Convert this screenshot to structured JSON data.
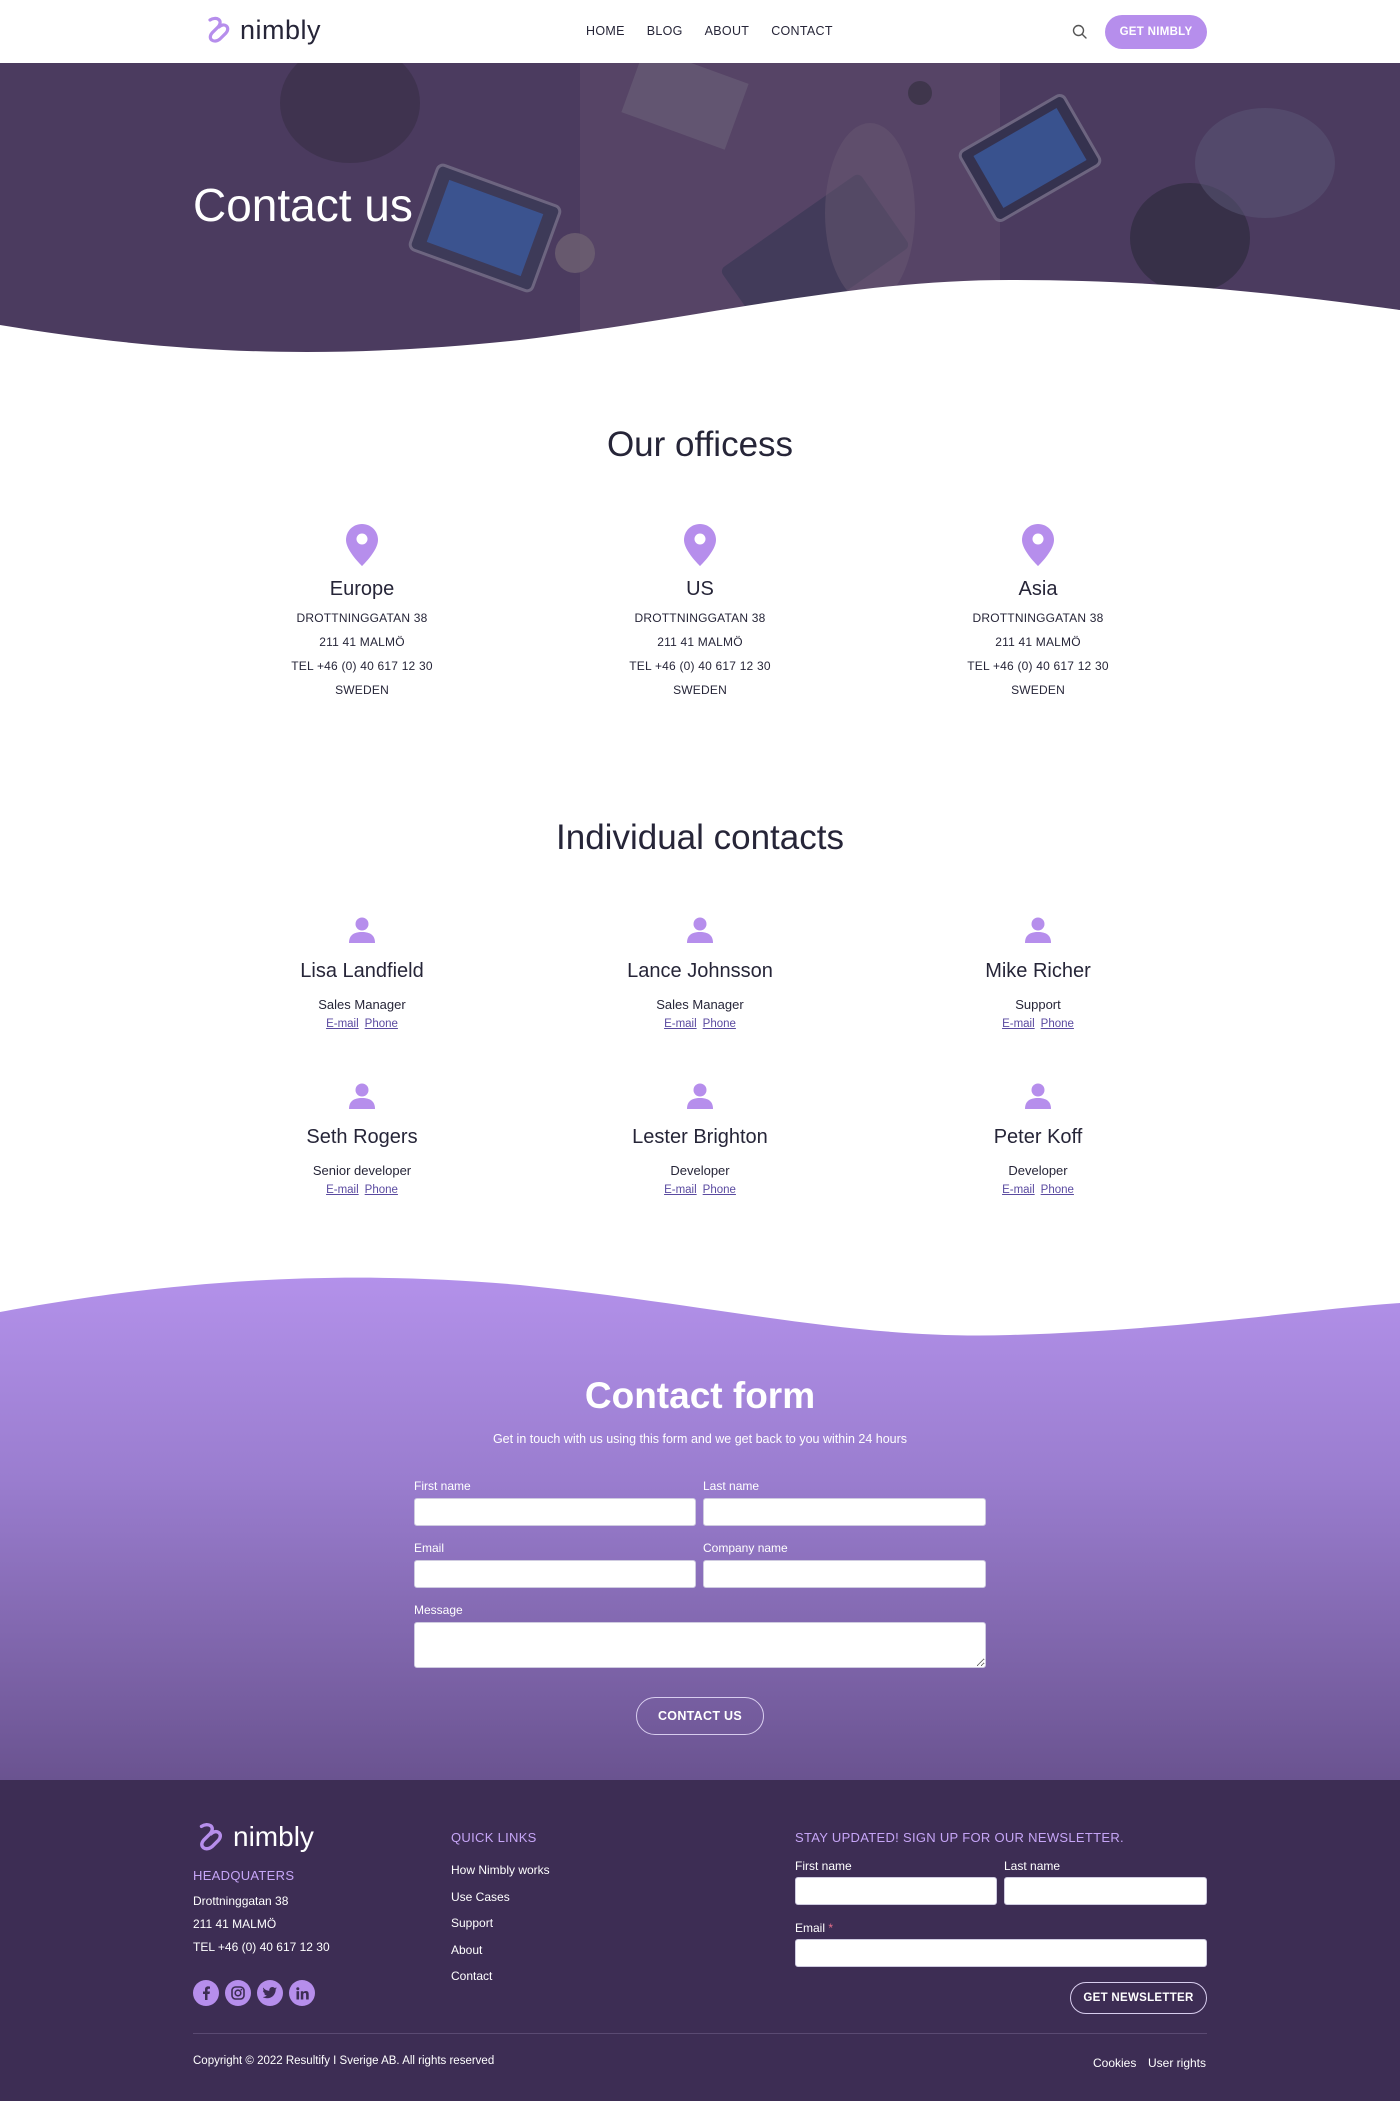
{
  "header": {
    "logo_text": "nimbly",
    "nav": [
      "HOME",
      "BLOG",
      "ABOUT",
      "CONTACT"
    ],
    "cta_label": "GET NIMBLY"
  },
  "hero": {
    "title": "Contact us"
  },
  "offices": {
    "title": "Our officess",
    "items": [
      {
        "name": "Europe",
        "lines": [
          "DROTTNINGGATAN 38",
          "211 41 MALMÖ",
          "TEL +46 (0) 40 617 12 30",
          "SWEDEN"
        ]
      },
      {
        "name": "US",
        "lines": [
          "DROTTNINGGATAN 38",
          "211 41 MALMÖ",
          "TEL +46 (0) 40 617 12 30",
          "SWEDEN"
        ]
      },
      {
        "name": "Asia",
        "lines": [
          "DROTTNINGGATAN 38",
          "211 41 MALMÖ",
          "TEL +46 (0) 40 617 12 30",
          "SWEDEN"
        ]
      }
    ]
  },
  "contacts": {
    "title": "Individual contacts",
    "email_label": "E-mail",
    "phone_label": "Phone",
    "people": [
      {
        "name": "Lisa Landfield",
        "role": "Sales Manager"
      },
      {
        "name": "Lance Johnsson",
        "role": "Sales Manager"
      },
      {
        "name": "Mike Richer",
        "role": "Support"
      },
      {
        "name": "Seth Rogers",
        "role": "Senior developer"
      },
      {
        "name": "Lester Brighton",
        "role": "Developer"
      },
      {
        "name": "Peter Koff",
        "role": "Developer"
      }
    ]
  },
  "form": {
    "title": "Contact form",
    "subtitle": "Get in touch with us using this form and we get back to you within 24 hours",
    "first_name_label": "First name",
    "last_name_label": "Last name",
    "email_label": "Email",
    "company_label": "Company name",
    "message_label": "Message",
    "submit_label": "CONTACT US"
  },
  "footer": {
    "logo_text": "nimbly",
    "hq_title": "HEADQUATERS",
    "hq_lines": [
      "Drottninggatan 38",
      "211 41 MALMÖ",
      "TEL +46 (0) 40 617 12 30"
    ],
    "quick_links_title": "QUICK LINKS",
    "quick_links": [
      "How Nimbly works",
      "Use Cases",
      "Support",
      "About",
      "Contact"
    ],
    "newsletter_title": "STAY UPDATED! SIGN UP FOR OUR NEWSLETTER.",
    "nl_first_name_label": "First name",
    "nl_last_name_label": "Last name",
    "nl_email_label": "Email",
    "nl_required_mark": "*",
    "nl_submit_label": "GET NEWSLETTER",
    "copyright": "Copyright © 2022 Resultify I Sverige AB. All rights reserved",
    "bottom_links": [
      "Cookies",
      "User rights"
    ],
    "social": [
      "facebook-icon",
      "instagram-icon",
      "twitter-icon",
      "linkedin-icon"
    ]
  },
  "colors": {
    "accent": "#b68eec",
    "dark": "#262538",
    "footer_bg": "#3d2d54",
    "form_gradient_top": "#ac8ae3",
    "form_gradient_bottom": "#6a5390"
  }
}
